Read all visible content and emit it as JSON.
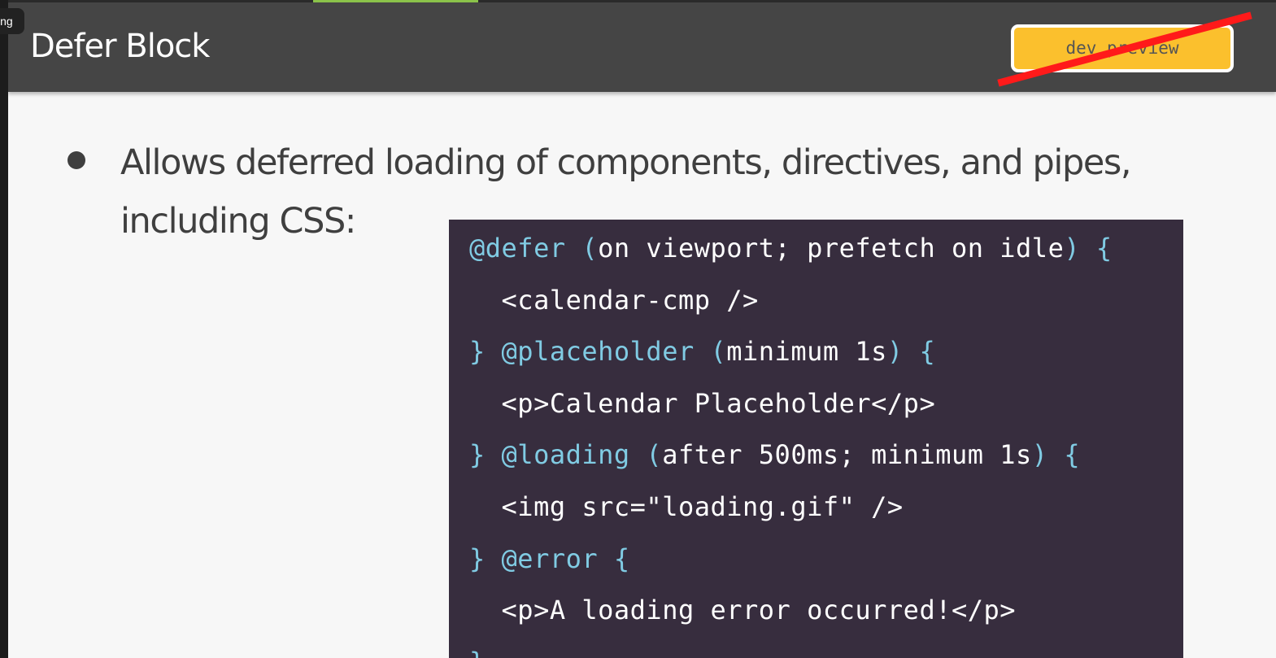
{
  "overlay": {
    "label": "ing"
  },
  "slide": {
    "title": "Defer Block",
    "badge": "dev preview",
    "bullet": "Allows deferred loading of components, directives, and pipes, including CSS:"
  },
  "code": {
    "lines": [
      [
        {
          "t": "@defer",
          "k": true
        },
        {
          "t": " ",
          "k": false
        },
        {
          "t": "(",
          "k": true
        },
        {
          "t": "on viewport; prefetch on idle",
          "k": false
        },
        {
          "t": ")",
          "k": true
        },
        {
          "t": " ",
          "k": false
        },
        {
          "t": "{",
          "k": true
        }
      ],
      [
        {
          "t": "  <calendar-cmp />",
          "k": false
        }
      ],
      [
        {
          "t": "}",
          "k": true
        },
        {
          "t": " ",
          "k": false
        },
        {
          "t": "@placeholder",
          "k": true
        },
        {
          "t": " ",
          "k": false
        },
        {
          "t": "(",
          "k": true
        },
        {
          "t": "minimum 1s",
          "k": false
        },
        {
          "t": ")",
          "k": true
        },
        {
          "t": " ",
          "k": false
        },
        {
          "t": "{",
          "k": true
        }
      ],
      [
        {
          "t": "  <p>Calendar Placeholder</p>",
          "k": false
        }
      ],
      [
        {
          "t": "}",
          "k": true
        },
        {
          "t": " ",
          "k": false
        },
        {
          "t": "@loading",
          "k": true
        },
        {
          "t": " ",
          "k": false
        },
        {
          "t": "(",
          "k": true
        },
        {
          "t": "after 500ms; minimum 1s",
          "k": false
        },
        {
          "t": ")",
          "k": true
        },
        {
          "t": " ",
          "k": false
        },
        {
          "t": "{",
          "k": true
        }
      ],
      [
        {
          "t": "  <img src=\"loading.gif\" />",
          "k": false
        }
      ],
      [
        {
          "t": "}",
          "k": true
        },
        {
          "t": " ",
          "k": false
        },
        {
          "t": "@error",
          "k": true
        },
        {
          "t": " ",
          "k": false
        },
        {
          "t": "{",
          "k": true
        }
      ],
      [
        {
          "t": "  <p>A loading error occurred!</p>",
          "k": false
        }
      ],
      [
        {
          "t": "}",
          "k": true
        }
      ]
    ]
  },
  "colors": {
    "header_bg": "#454545",
    "badge_bg": "#fbc02d",
    "strike": "#ff1a1a",
    "code_bg": "#372d3e",
    "code_keyword": "#80cbe3",
    "code_text": "#f3f3f3"
  }
}
